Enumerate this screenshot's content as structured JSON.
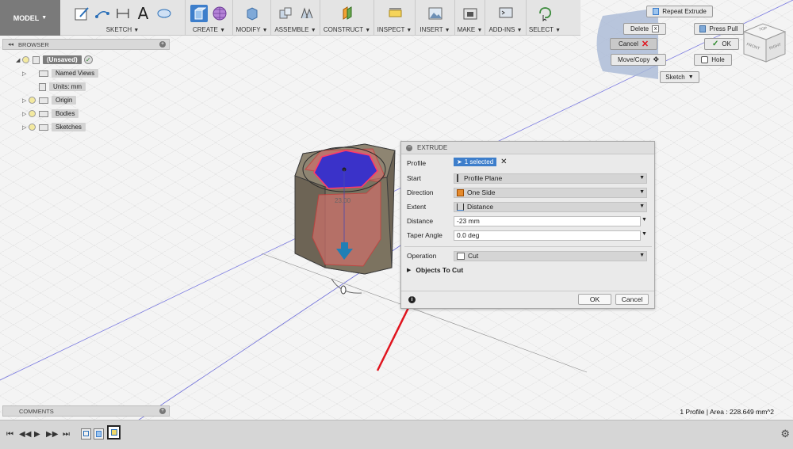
{
  "toolbar": {
    "model_label": "MODEL",
    "groups": [
      {
        "label": "SKETCH"
      },
      {
        "label": "CREATE"
      },
      {
        "label": "MODIFY"
      },
      {
        "label": "ASSEMBLE"
      },
      {
        "label": "CONSTRUCT"
      },
      {
        "label": "INSPECT"
      },
      {
        "label": "INSERT"
      },
      {
        "label": "MAKE"
      },
      {
        "label": "ADD-INS"
      },
      {
        "label": "SELECT"
      }
    ]
  },
  "browser": {
    "title": "BROWSER",
    "items": [
      {
        "label": "(Unsaved)"
      },
      {
        "label": "Named Views"
      },
      {
        "label": "Units: mm"
      },
      {
        "label": "Origin"
      },
      {
        "label": "Bodies"
      },
      {
        "label": "Sketches"
      }
    ]
  },
  "comments": {
    "title": "COMMENTS"
  },
  "marking_menu": {
    "repeat": "Repeat Extrude",
    "delete": "Delete",
    "press_pull": "Press Pull",
    "cancel": "Cancel",
    "ok": "OK",
    "move_copy": "Move/Copy",
    "hole": "Hole",
    "sketch": "Sketch"
  },
  "viewcube": {
    "top": "TOP",
    "front": "FRONT",
    "right": "RIGHT"
  },
  "viewport": {
    "dimension_value": "23.00"
  },
  "dialog": {
    "title": "EXTRUDE",
    "profile_label": "Profile",
    "profile_value": "1 selected",
    "start_label": "Start",
    "start_value": "Profile Plane",
    "direction_label": "Direction",
    "direction_value": "One Side",
    "extent_label": "Extent",
    "extent_value": "Distance",
    "distance_label": "Distance",
    "distance_value": "-23 mm",
    "taper_label": "Taper Angle",
    "taper_value": "0.0 deg",
    "operation_label": "Operation",
    "operation_value": "Cut",
    "objects_to_cut": "Objects To Cut",
    "ok": "OK",
    "cancel": "Cancel"
  },
  "status": {
    "text": "1 Profile | Area : 228.649 mm^2"
  },
  "colors": {
    "accent": "#3d7ecb",
    "annotation_arrow": "#e0141e",
    "profile_fill": "#3a32c9",
    "cut_body": "#c9706a"
  }
}
